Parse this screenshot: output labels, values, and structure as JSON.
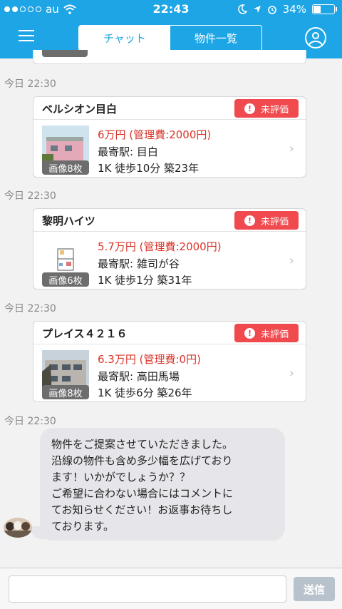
{
  "status_bar": {
    "carrier": "au",
    "time": "22:43",
    "battery": "34%",
    "battery_level": 0.34
  },
  "header": {
    "tabs": [
      {
        "label": "チャット",
        "active": true
      },
      {
        "label": "物件一覧",
        "active": false
      }
    ],
    "icons": [
      "hamburger-menu-icon",
      "user-profile-icon"
    ],
    "accent_color": "#1da5e6"
  },
  "messages": [
    {
      "timestamp": "今日 22:30",
      "property": {
        "name": "ベルシオン目白",
        "badge": "未評価",
        "price": "6万円 (管理費:2000円)",
        "station": "最寄駅:  目白",
        "spec": "1K  徒歩10分  築23年",
        "images": "画像8枚"
      }
    },
    {
      "timestamp": "今日 22:30",
      "property": {
        "name": "黎明ハイツ",
        "badge": "未評価",
        "price": "5.7万円 (管理費:2000円)",
        "station": "最寄駅:  雑司が谷",
        "spec": "1K  徒歩1分  築31年",
        "images": "画像6枚"
      }
    },
    {
      "timestamp": "今日 22:30",
      "property": {
        "name": "プレイス４２１６",
        "badge": "未評価",
        "price": "6.3万円 (管理費:0円)",
        "station": "最寄駅:  高田馬場",
        "spec": "1K  徒歩6分  築26年",
        "images": "画像8枚"
      }
    },
    {
      "timestamp": "今日 22:30",
      "text_lines": [
        "物件をご提案させていただきました。",
        "沿線の物件も含め多少幅を広げており",
        "ます！いかがでしょうか？？",
        "ご希望に合わない場合にはコメントに",
        "てお知らせください！お返事お待ちし",
        "ております。"
      ]
    }
  ],
  "composer": {
    "input_value": "",
    "send_label": "送信"
  },
  "colors": {
    "badge": "#f04a4e",
    "price": "#d9342a",
    "bubble": "#e5e5ea"
  }
}
